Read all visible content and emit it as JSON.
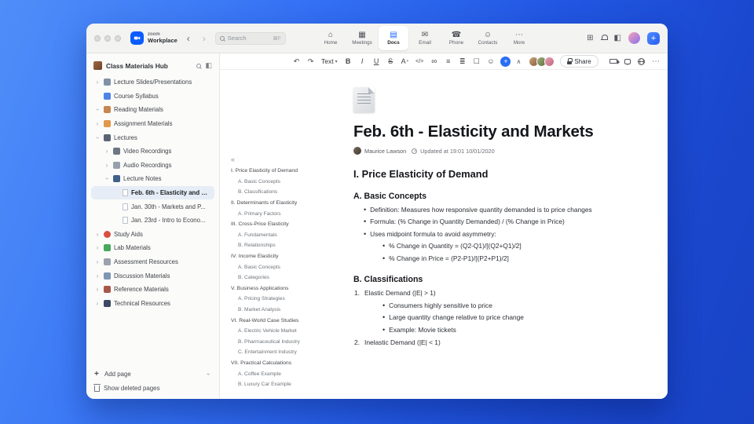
{
  "theme": {
    "accent": "#1a66ff",
    "selection_bg": "#e7edf6"
  },
  "icons": {
    "back": "‹",
    "forward": "›",
    "apps": "⊞",
    "side_panel": "◧",
    "outline_collapse": "«",
    "collapse_up": "∧",
    "plus": "+",
    "more": "⋯"
  },
  "titlebar": {
    "brand_small": "zoom",
    "brand_bold": "Workplace",
    "search_placeholder": "Search",
    "search_shortcut": "⌘F",
    "tabs": [
      {
        "name": "tab-home",
        "label": "Home",
        "glyph": "⌂"
      },
      {
        "name": "tab-meetings",
        "label": "Meetings",
        "glyph": "▦"
      },
      {
        "name": "tab-docs",
        "label": "Docs",
        "glyph": "▤",
        "cls": "active"
      },
      {
        "name": "tab-email",
        "label": "Email",
        "glyph": "✉"
      },
      {
        "name": "tab-phone",
        "label": "Phone",
        "glyph": "☎"
      },
      {
        "name": "tab-contacts",
        "label": "Contacts",
        "glyph": "☺"
      },
      {
        "name": "tab-more",
        "label": "More",
        "glyph": "⋯"
      }
    ]
  },
  "sidebar": {
    "title": "Class Materials Hub",
    "items": [
      {
        "name": "sidebar-item-lecture-slides",
        "label": "Lecture Slides/Presentations",
        "cls": "lv0",
        "chev": "right",
        "icon": "slides"
      },
      {
        "name": "sidebar-item-course-syllabus",
        "label": "Course Syllabus",
        "cls": "lv0",
        "chev": "none",
        "icon": "syllabus"
      },
      {
        "name": "sidebar-item-reading-materials",
        "label": "Reading Materials",
        "cls": "lv0",
        "chev": "down",
        "icon": "book"
      },
      {
        "name": "sidebar-item-assignment-materials",
        "label": "Assignment Materials",
        "cls": "lv0",
        "chev": "right",
        "icon": "assignment"
      },
      {
        "name": "sidebar-item-lectures",
        "label": "Lectures",
        "cls": "lv0",
        "chev": "down",
        "icon": "lectures"
      },
      {
        "name": "sidebar-item-video-recordings",
        "label": "Video Recordings",
        "cls": "lv1",
        "chev": "right",
        "icon": "video"
      },
      {
        "name": "sidebar-item-audio-recordings",
        "label": "Audio Recordings",
        "cls": "lv1",
        "chev": "right",
        "icon": "audio"
      },
      {
        "name": "sidebar-item-lecture-notes",
        "label": "Lecture Notes",
        "cls": "lv1",
        "chev": "down",
        "icon": "notes"
      },
      {
        "name": "sidebar-item-note-feb-6",
        "label": "Feb. 6th - Elasticity and M...",
        "cls": "lv2 selected",
        "chev": "none",
        "icon": "page"
      },
      {
        "name": "sidebar-item-note-jan-30",
        "label": "Jan. 30th - Markets and P...",
        "cls": "lv2",
        "chev": "none",
        "icon": "page"
      },
      {
        "name": "sidebar-item-note-jan-23",
        "label": "Jan. 23rd - Intro to Econo...",
        "cls": "lv2",
        "chev": "none",
        "icon": "page"
      },
      {
        "name": "sidebar-item-study-aids",
        "label": "Study Aids",
        "cls": "lv0",
        "chev": "right",
        "icon": "apple"
      },
      {
        "name": "sidebar-item-lab-materials",
        "label": "Lab Materials",
        "cls": "lv0",
        "chev": "right",
        "icon": "lab"
      },
      {
        "name": "sidebar-item-assessment-resources",
        "label": "Assessment Resources",
        "cls": "lv0",
        "chev": "right",
        "icon": "clipboard"
      },
      {
        "name": "sidebar-item-discussion-materials",
        "label": "Discussion Materials",
        "cls": "lv0",
        "chev": "right",
        "icon": "discussion"
      },
      {
        "name": "sidebar-item-reference-materials",
        "label": "Reference Materials",
        "cls": "lv0",
        "chev": "right",
        "icon": "reference"
      },
      {
        "name": "sidebar-item-technical-resources",
        "label": "Technical Resources",
        "cls": "lv0",
        "chev": "right",
        "icon": "technical"
      }
    ],
    "footer": {
      "add_page": "Add page",
      "show_deleted": "Show deleted pages"
    }
  },
  "toolbar": {
    "text_style": "Text",
    "share": "Share",
    "history_icons": [
      {
        "name": "undo-button",
        "glyph": "↶"
      },
      {
        "name": "redo-button",
        "glyph": "↷"
      }
    ],
    "format_icons": [
      {
        "name": "bold-button",
        "glyph": "B"
      },
      {
        "name": "italic-button",
        "glyph": "I"
      },
      {
        "name": "underline-button",
        "glyph": "U"
      },
      {
        "name": "strikethrough-button",
        "glyph": "S"
      },
      {
        "name": "text-color-button",
        "glyph": "A"
      },
      {
        "name": "code-button",
        "glyph": "</>"
      },
      {
        "name": "link-button",
        "glyph": "∞"
      },
      {
        "name": "bulleted-list-button",
        "glyph": "≡"
      },
      {
        "name": "numbered-list-button",
        "glyph": "≣"
      },
      {
        "name": "checklist-button",
        "glyph": "☐"
      },
      {
        "name": "emoji-button",
        "glyph": "☺"
      }
    ]
  },
  "outline": {
    "items": [
      {
        "label": "I. Price Elasticity of Demand",
        "cls": "lv0"
      },
      {
        "label": "A. Basic Concepts",
        "cls": "lv1"
      },
      {
        "label": "B. Classifications",
        "cls": "lv1"
      },
      {
        "label": "II. Determinants of Elasticity",
        "cls": "lv0"
      },
      {
        "label": "A. Primary Factors",
        "cls": "lv1"
      },
      {
        "label": "III. Cross-Price Elasticity",
        "cls": "lv0"
      },
      {
        "label": "A. Fundamentals",
        "cls": "lv1"
      },
      {
        "label": "B. Relationships",
        "cls": "lv1"
      },
      {
        "label": "IV. Income Elasticity",
        "cls": "lv0"
      },
      {
        "label": "A. Basic Concepts",
        "cls": "lv1"
      },
      {
        "label": "B. Categories",
        "cls": "lv1"
      },
      {
        "label": "V. Business Applications",
        "cls": "lv0"
      },
      {
        "label": "A. Pricing Strategies",
        "cls": "lv1"
      },
      {
        "label": "B. Market Analysis",
        "cls": "lv1"
      },
      {
        "label": "VI. Real-World Case Studies",
        "cls": "lv0"
      },
      {
        "label": "A. Electric Vehicle Market",
        "cls": "lv1"
      },
      {
        "label": "B. Pharmaceutical Industry",
        "cls": "lv1"
      },
      {
        "label": "C. Entertainment Industry",
        "cls": "lv1"
      },
      {
        "label": "VII. Practical Calculations",
        "cls": "lv0"
      },
      {
        "label": "A. Coffee Example",
        "cls": "lv1"
      },
      {
        "label": "B. Luxury Car Example",
        "cls": "lv1"
      }
    ]
  },
  "document": {
    "title": "Feb. 6th - Elasticity and Markets",
    "author": "Maurice Lawson",
    "updated": "Updated at 19:01 10/01/2020",
    "blocks": [
      {
        "name": "doc-heading-1",
        "cls": "t-h2",
        "text": "I. Price Elasticity of Demand"
      },
      {
        "name": "doc-heading-1a",
        "cls": "t-h3",
        "text": "A. Basic Concepts"
      },
      {
        "cls": "t-bullet",
        "text": "Definition: Measures how responsive quantity demanded is to price changes"
      },
      {
        "cls": "t-bullet",
        "text": "Formula: (% Change in Quantity Demanded) / (% Change in Price)"
      },
      {
        "cls": "t-bullet",
        "text": "Uses midpoint formula to avoid asymmetry:"
      },
      {
        "cls": "t-bullet2",
        "text": "% Change in Quantity = (Q2-Q1)/[(Q2+Q1)/2]"
      },
      {
        "cls": "t-bullet2",
        "text": "% Change in Price = (P2-P1)/[(P2+P1)/2]"
      },
      {
        "name": "doc-heading-1b",
        "cls": "t-h3",
        "text": "B. Classifications"
      },
      {
        "cls": "t-num",
        "marker": "1.",
        "text": "Elastic Demand (|E| > 1)"
      },
      {
        "cls": "t-bullet2",
        "text": "Consumers highly sensitive to price"
      },
      {
        "cls": "t-bullet2",
        "text": "Large quantity change relative to price change"
      },
      {
        "cls": "t-bullet2",
        "text": "Example: Movie tickets"
      },
      {
        "cls": "t-num",
        "marker": "2.",
        "text": "Inelastic Demand (|E| < 1)"
      }
    ]
  }
}
